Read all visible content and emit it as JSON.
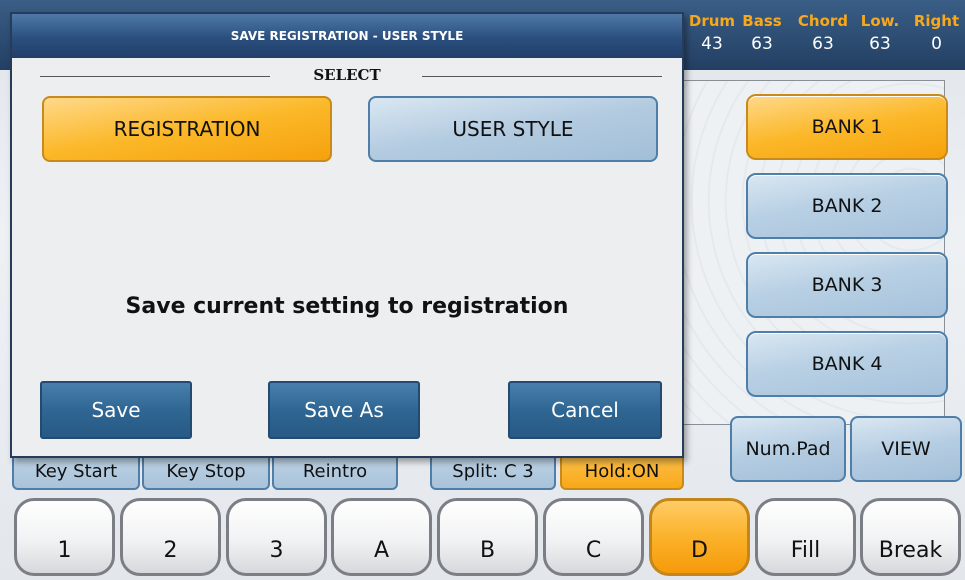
{
  "mixer": {
    "channels": [
      {
        "label": "Drum",
        "value": "43"
      },
      {
        "label": "Bass",
        "value": "63"
      },
      {
        "label": "Chord",
        "value": "63"
      },
      {
        "label": "Low.",
        "value": "63"
      },
      {
        "label": "Right",
        "value": "0"
      }
    ]
  },
  "banks": [
    "BANK 1",
    "BANK 2",
    "BANK 3",
    "BANK 4"
  ],
  "active_bank": "BANK 1",
  "side_buttons": {
    "numpad": "Num.Pad",
    "view": "VIEW"
  },
  "strip_buttons": [
    "Key Start",
    "Key Stop",
    "Reintro",
    "Split: C 3",
    "Hold:ON"
  ],
  "pads": [
    "1",
    "2",
    "3",
    "A",
    "B",
    "C",
    "D",
    "Fill",
    "Break"
  ],
  "active_pad": "D",
  "dialog": {
    "title": "SAVE REGISTRATION - USER STYLE",
    "select_label": "SELECT",
    "options": {
      "registration": "REGISTRATION",
      "user_style": "USER STYLE"
    },
    "active_option": "REGISTRATION",
    "message": "Save current setting to registration",
    "actions": {
      "save": "Save",
      "save_as": "Save As",
      "cancel": "Cancel"
    }
  },
  "colors": {
    "accent": "#f8a818",
    "panel_blue": "#a9c3da",
    "title_blue": "#2a4f7e"
  }
}
